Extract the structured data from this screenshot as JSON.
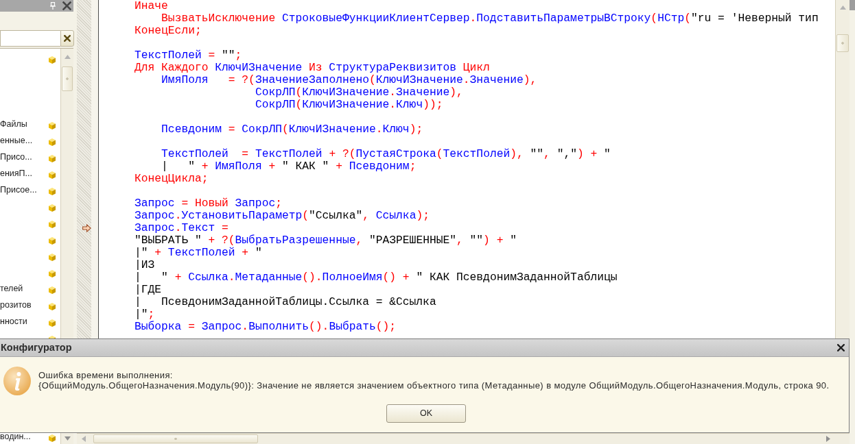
{
  "side_panel": {
    "tree": {
      "items": [
        {
          "kind": "item"
        },
        {
          "kind": "blank"
        },
        {
          "kind": "blank"
        },
        {
          "kind": "blank"
        },
        {
          "kind": "item",
          "label": "Файлы"
        },
        {
          "kind": "item",
          "label": "енные..."
        },
        {
          "kind": "item",
          "label": "Присо..."
        },
        {
          "kind": "item",
          "label": "енияП..."
        },
        {
          "kind": "item",
          "label": "Присое..."
        },
        {
          "kind": "item"
        },
        {
          "kind": "item"
        },
        {
          "kind": "item"
        },
        {
          "kind": "item"
        },
        {
          "kind": "item"
        },
        {
          "kind": "item",
          "label": "телей"
        },
        {
          "kind": "item",
          "label": "розитов"
        },
        {
          "kind": "item",
          "label": "нности"
        },
        {
          "kind": "item"
        },
        {
          "kind": "item",
          "label": "водин..."
        }
      ]
    }
  },
  "editor": {
    "lines": [
      {
        "current": false,
        "tokens": [
          {
            "kind": "keyword",
            "text": "Иначе"
          }
        ]
      },
      {
        "current": false,
        "tokens": [
          {
            "kind": "keyword",
            "text": "    ВызватьИсключение "
          },
          {
            "kind": "name",
            "text": "СтроковыеФункцииКлиентСервер"
          },
          {
            "kind": "op",
            "text": "."
          },
          {
            "kind": "name",
            "text": "ПодставитьПараметрыВСтроку"
          },
          {
            "kind": "op",
            "text": "("
          },
          {
            "kind": "name",
            "text": "НСтр"
          },
          {
            "kind": "op",
            "text": "("
          },
          {
            "kind": "string",
            "text": "\"ru = 'Неверный тип"
          }
        ]
      },
      {
        "current": false,
        "tokens": [
          {
            "kind": "keyword",
            "text": "КонецЕсли"
          },
          {
            "kind": "op",
            "text": ";"
          }
        ]
      },
      {
        "current": false
      },
      {
        "current": false,
        "tokens": [
          {
            "kind": "name",
            "text": "ТекстПолей"
          },
          {
            "kind": "op",
            "text": " = "
          },
          {
            "kind": "string",
            "text": "\"\""
          },
          {
            "kind": "op",
            "text": ";"
          }
        ]
      },
      {
        "current": false,
        "tokens": [
          {
            "kind": "keyword",
            "text": "Для Каждого "
          },
          {
            "kind": "name",
            "text": "КлючИЗначение"
          },
          {
            "kind": "keyword",
            "text": " Из "
          },
          {
            "kind": "name",
            "text": "СтруктураРеквизитов"
          },
          {
            "kind": "keyword",
            "text": " Цикл"
          }
        ]
      },
      {
        "current": false,
        "tokens": [
          {
            "kind": "name",
            "text": "    ИмяПоля"
          },
          {
            "kind": "op",
            "text": "   = ?("
          },
          {
            "kind": "name",
            "text": "ЗначениеЗаполнено"
          },
          {
            "kind": "op",
            "text": "("
          },
          {
            "kind": "name",
            "text": "КлючИЗначение"
          },
          {
            "kind": "op",
            "text": "."
          },
          {
            "kind": "name",
            "text": "Значение"
          },
          {
            "kind": "op",
            "text": "),"
          }
        ]
      },
      {
        "current": false,
        "tokens": [
          {
            "kind": "name",
            "text": "                  СокрЛП"
          },
          {
            "kind": "op",
            "text": "("
          },
          {
            "kind": "name",
            "text": "КлючИЗначение"
          },
          {
            "kind": "op",
            "text": "."
          },
          {
            "kind": "name",
            "text": "Значение"
          },
          {
            "kind": "op",
            "text": "),"
          }
        ]
      },
      {
        "current": false,
        "tokens": [
          {
            "kind": "name",
            "text": "                  СокрЛП"
          },
          {
            "kind": "op",
            "text": "("
          },
          {
            "kind": "name",
            "text": "КлючИЗначение"
          },
          {
            "kind": "op",
            "text": "."
          },
          {
            "kind": "name",
            "text": "Ключ"
          },
          {
            "kind": "op",
            "text": "));"
          }
        ]
      },
      {
        "current": false
      },
      {
        "current": false,
        "tokens": [
          {
            "kind": "name",
            "text": "    Псевдоним"
          },
          {
            "kind": "op",
            "text": " = "
          },
          {
            "kind": "name",
            "text": "СокрЛП"
          },
          {
            "kind": "op",
            "text": "("
          },
          {
            "kind": "name",
            "text": "КлючИЗначение"
          },
          {
            "kind": "op",
            "text": "."
          },
          {
            "kind": "name",
            "text": "Ключ"
          },
          {
            "kind": "op",
            "text": ");"
          }
        ]
      },
      {
        "current": false
      },
      {
        "current": false,
        "tokens": [
          {
            "kind": "name",
            "text": "    ТекстПолей"
          },
          {
            "kind": "op",
            "text": "  = "
          },
          {
            "kind": "name",
            "text": "ТекстПолей"
          },
          {
            "kind": "op",
            "text": " + ?("
          },
          {
            "kind": "name",
            "text": "ПустаяСтрока"
          },
          {
            "kind": "op",
            "text": "("
          },
          {
            "kind": "name",
            "text": "ТекстПолей"
          },
          {
            "kind": "op",
            "text": "), "
          },
          {
            "kind": "string",
            "text": "\"\""
          },
          {
            "kind": "op",
            "text": ", "
          },
          {
            "kind": "string",
            "text": "\",\""
          },
          {
            "kind": "op",
            "text": ") + "
          },
          {
            "kind": "string",
            "text": "\""
          }
        ]
      },
      {
        "current": false,
        "tokens": [
          {
            "kind": "string",
            "text": "    |   \""
          },
          {
            "kind": "op",
            "text": " + "
          },
          {
            "kind": "name",
            "text": "ИмяПоля"
          },
          {
            "kind": "op",
            "text": " + "
          },
          {
            "kind": "string",
            "text": "\" КАК \""
          },
          {
            "kind": "op",
            "text": " + "
          },
          {
            "kind": "name",
            "text": "Псевдоним"
          },
          {
            "kind": "op",
            "text": ";"
          }
        ]
      },
      {
        "current": false,
        "tokens": [
          {
            "kind": "keyword",
            "text": "КонецЦикла"
          },
          {
            "kind": "op",
            "text": ";"
          }
        ]
      },
      {
        "current": false
      },
      {
        "current": false,
        "tokens": [
          {
            "kind": "name",
            "text": "Запрос"
          },
          {
            "kind": "op",
            "text": " = "
          },
          {
            "kind": "keyword",
            "text": "Новый "
          },
          {
            "kind": "name",
            "text": "Запрос"
          },
          {
            "kind": "op",
            "text": ";"
          }
        ]
      },
      {
        "current": false,
        "tokens": [
          {
            "kind": "name",
            "text": "Запрос"
          },
          {
            "kind": "op",
            "text": "."
          },
          {
            "kind": "name",
            "text": "УстановитьПараметр"
          },
          {
            "kind": "op",
            "text": "("
          },
          {
            "kind": "string",
            "text": "\"Ссылка\""
          },
          {
            "kind": "op",
            "text": ", "
          },
          {
            "kind": "name",
            "text": "Ссылка"
          },
          {
            "kind": "op",
            "text": ");"
          }
        ]
      },
      {
        "current": true,
        "tokens": [
          {
            "kind": "name",
            "text": "Запрос"
          },
          {
            "kind": "op",
            "text": "."
          },
          {
            "kind": "name",
            "text": "Текст"
          },
          {
            "kind": "op",
            "text": " ="
          }
        ]
      },
      {
        "current": false,
        "tokens": [
          {
            "kind": "string",
            "text": "\"ВЫБРАТЬ \""
          },
          {
            "kind": "op",
            "text": " + ?("
          },
          {
            "kind": "name",
            "text": "ВыбратьРазрешенные"
          },
          {
            "kind": "op",
            "text": ", "
          },
          {
            "kind": "string",
            "text": "\"РАЗРЕШЕННЫЕ\""
          },
          {
            "kind": "op",
            "text": ", "
          },
          {
            "kind": "string",
            "text": "\"\""
          },
          {
            "kind": "op",
            "text": ") + "
          },
          {
            "kind": "string",
            "text": "\""
          }
        ]
      },
      {
        "current": false,
        "tokens": [
          {
            "kind": "string",
            "text": "|\""
          },
          {
            "kind": "op",
            "text": " + "
          },
          {
            "kind": "name",
            "text": "ТекстПолей"
          },
          {
            "kind": "op",
            "text": " + "
          },
          {
            "kind": "string",
            "text": "\""
          }
        ]
      },
      {
        "current": false,
        "tokens": [
          {
            "kind": "string",
            "text": "|ИЗ"
          }
        ]
      },
      {
        "current": false,
        "tokens": [
          {
            "kind": "string",
            "text": "|   \""
          },
          {
            "kind": "op",
            "text": " + "
          },
          {
            "kind": "name",
            "text": "Ссылка"
          },
          {
            "kind": "op",
            "text": "."
          },
          {
            "kind": "name",
            "text": "Метаданные"
          },
          {
            "kind": "op",
            "text": "()."
          },
          {
            "kind": "name",
            "text": "ПолноеИмя"
          },
          {
            "kind": "op",
            "text": "() + "
          },
          {
            "kind": "string",
            "text": "\" КАК ПсевдонимЗаданнойТаблицы"
          }
        ]
      },
      {
        "current": false,
        "tokens": [
          {
            "kind": "string",
            "text": "|ГДЕ"
          }
        ]
      },
      {
        "current": false,
        "tokens": [
          {
            "kind": "string",
            "text": "|   ПсевдонимЗаданнойТаблицы.Ссылка = &Ссылка"
          }
        ]
      },
      {
        "current": false,
        "tokens": [
          {
            "kind": "string",
            "text": "|\""
          },
          {
            "kind": "op",
            "text": ";"
          }
        ]
      },
      {
        "current": false,
        "tokens": [
          {
            "kind": "name",
            "text": "Выборка"
          },
          {
            "kind": "op",
            "text": " = "
          },
          {
            "kind": "name",
            "text": "Запрос"
          },
          {
            "kind": "op",
            "text": "."
          },
          {
            "kind": "name",
            "text": "Выполнить"
          },
          {
            "kind": "op",
            "text": "()."
          },
          {
            "kind": "name",
            "text": "Выбрать"
          },
          {
            "kind": "op",
            "text": "();"
          }
        ]
      }
    ]
  },
  "dialog": {
    "title": "Конфигуратор",
    "message": "Ошибка времени выполнения:",
    "details": "{ОбщийМодуль.ОбщегоНазначения.Модуль(90)}: Значение не является значением объектного типа (Метаданные) в модуле ОбщийМодуль.ОбщегоНазначения.Модуль, строка 90.",
    "buttons": [
      "OK"
    ]
  }
}
